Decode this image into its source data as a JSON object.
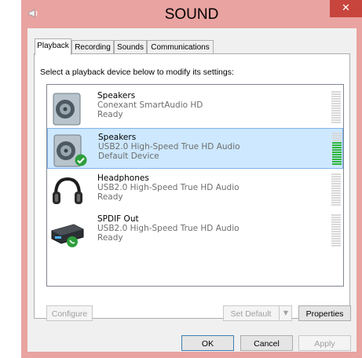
{
  "window": {
    "title": "SOUND",
    "close_glyph": "✕"
  },
  "tabs": [
    {
      "label": "Playback",
      "active": true
    },
    {
      "label": "Recording",
      "active": false
    },
    {
      "label": "Sounds",
      "active": false
    },
    {
      "label": "Communications",
      "active": false
    }
  ],
  "prompt": "Select a playback device below to modify its settings:",
  "devices": [
    {
      "name": "Speakers",
      "description": "Conexant SmartAudio HD",
      "status": "Ready",
      "icon": "speaker-icon",
      "selected": false,
      "default": false
    },
    {
      "name": "Speakers",
      "description": "USB2.0 High-Speed True HD Audio",
      "status": "Default Device",
      "icon": "speaker-icon",
      "selected": true,
      "default": true,
      "level": 0.75
    },
    {
      "name": "Headphones",
      "description": "USB2.0 High-Speed True HD Audio",
      "status": "Ready",
      "icon": "headphones-icon",
      "selected": false,
      "default": false
    },
    {
      "name": "SPDIF Out",
      "description": "USB2.0 High-Speed True HD Audio",
      "status": "Ready",
      "icon": "spdif-receiver-icon",
      "selected": false,
      "default": false
    }
  ],
  "buttons": {
    "configure": "Configure",
    "set_default": "Set Default",
    "properties": "Properties",
    "ok": "OK",
    "cancel": "Cancel",
    "apply": "Apply"
  },
  "colors": {
    "titlebar": "#e9a3a0",
    "close": "#c7453d",
    "selection": "#cde8ff",
    "meter_active": "#2fb53a"
  }
}
